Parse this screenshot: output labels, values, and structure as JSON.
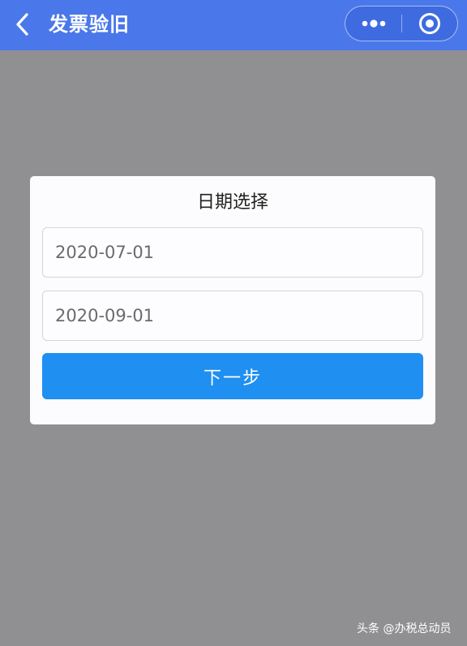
{
  "nav": {
    "title": "发票验旧",
    "background_color": "#4a78ea",
    "back_icon": "chevron-left-icon",
    "more_icon": "more-dots-icon",
    "close_icon": "target-circle-icon"
  },
  "dialog": {
    "title": "日期选择",
    "start_date": "2020-07-01",
    "end_date": "2020-09-01",
    "next_label": "下一步",
    "button_color": "#1f8ff1"
  },
  "overlay_color": "#909092",
  "watermark": {
    "text": "头条 @办税总动员"
  }
}
